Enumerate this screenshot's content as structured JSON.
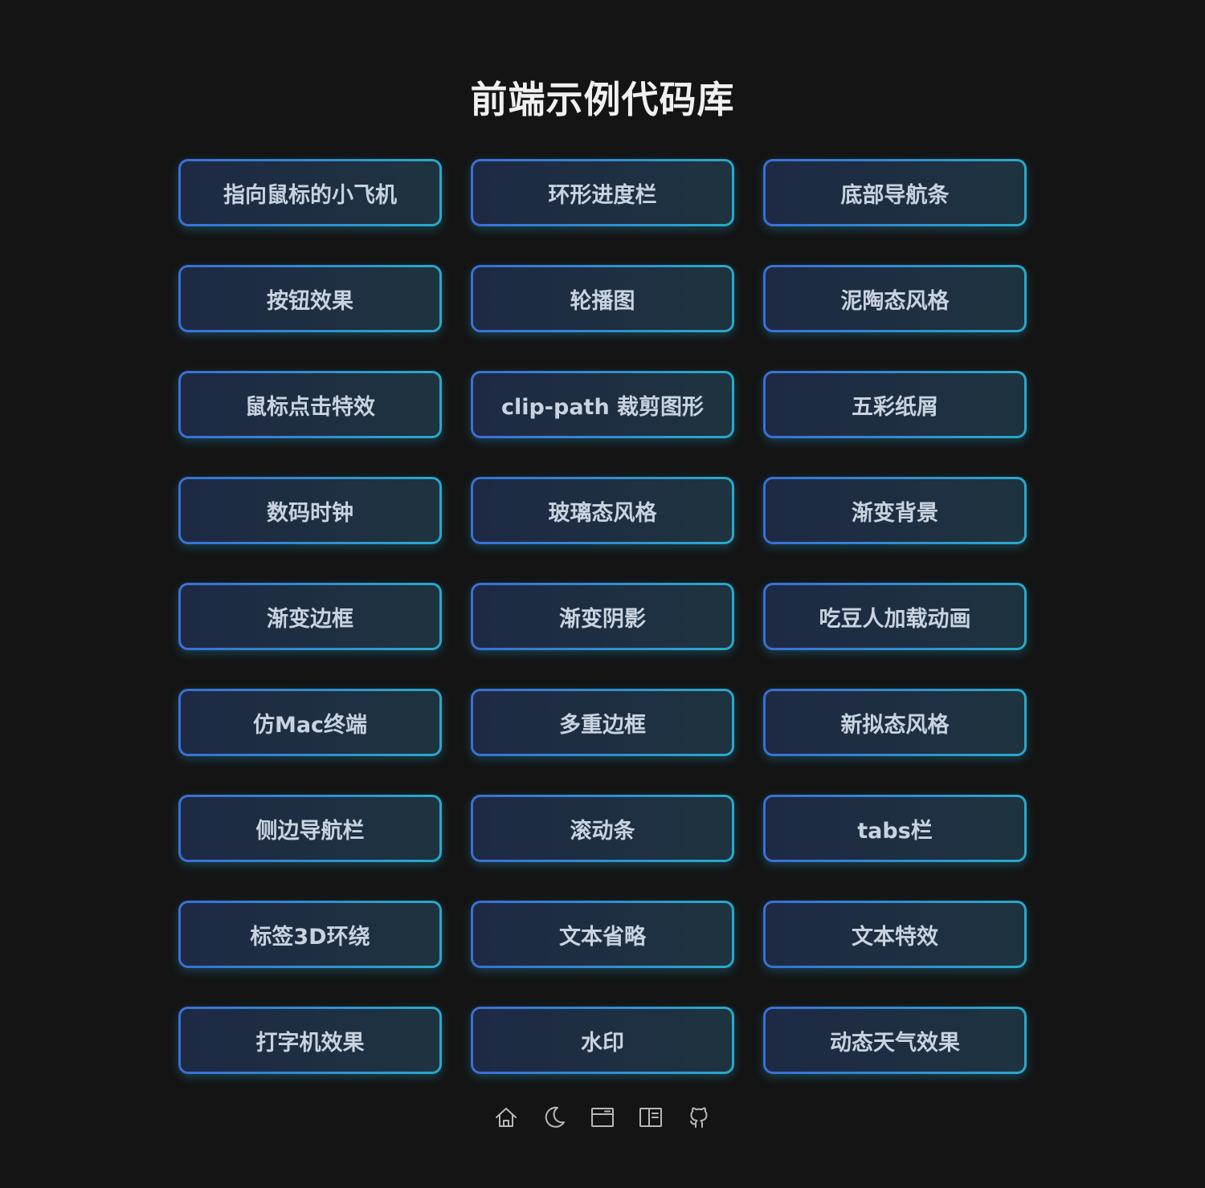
{
  "page": {
    "title": "前端示例代码库"
  },
  "cards": [
    {
      "label": "指向鼠标的小飞机"
    },
    {
      "label": "环形进度栏"
    },
    {
      "label": "底部导航条"
    },
    {
      "label": "按钮效果"
    },
    {
      "label": "轮播图"
    },
    {
      "label": "泥陶态风格"
    },
    {
      "label": "鼠标点击特效"
    },
    {
      "label": "clip-path 裁剪图形"
    },
    {
      "label": "五彩纸屑"
    },
    {
      "label": "数码时钟"
    },
    {
      "label": "玻璃态风格"
    },
    {
      "label": "渐变背景"
    },
    {
      "label": "渐变边框"
    },
    {
      "label": "渐变阴影"
    },
    {
      "label": "吃豆人加载动画"
    },
    {
      "label": "仿Mac终端"
    },
    {
      "label": "多重边框"
    },
    {
      "label": "新拟态风格"
    },
    {
      "label": "侧边导航栏"
    },
    {
      "label": "滚动条"
    },
    {
      "label": "tabs栏"
    },
    {
      "label": "标签3D环绕"
    },
    {
      "label": "文本省略"
    },
    {
      "label": "文本特效"
    },
    {
      "label": "打字机效果"
    },
    {
      "label": "水印"
    },
    {
      "label": "动态天气效果"
    }
  ],
  "footer_icons": [
    "home-icon",
    "moon-icon",
    "window-icon",
    "layout-icon",
    "github-icon"
  ],
  "colors": {
    "background": "#141414",
    "title": "#f0f0f0",
    "card_fill": "#1e2a44",
    "card_border_start": "#3a6fd8",
    "card_border_end": "#2aa9c9",
    "card_text": "#c9d3e0",
    "icon": "#b8b8b8"
  }
}
